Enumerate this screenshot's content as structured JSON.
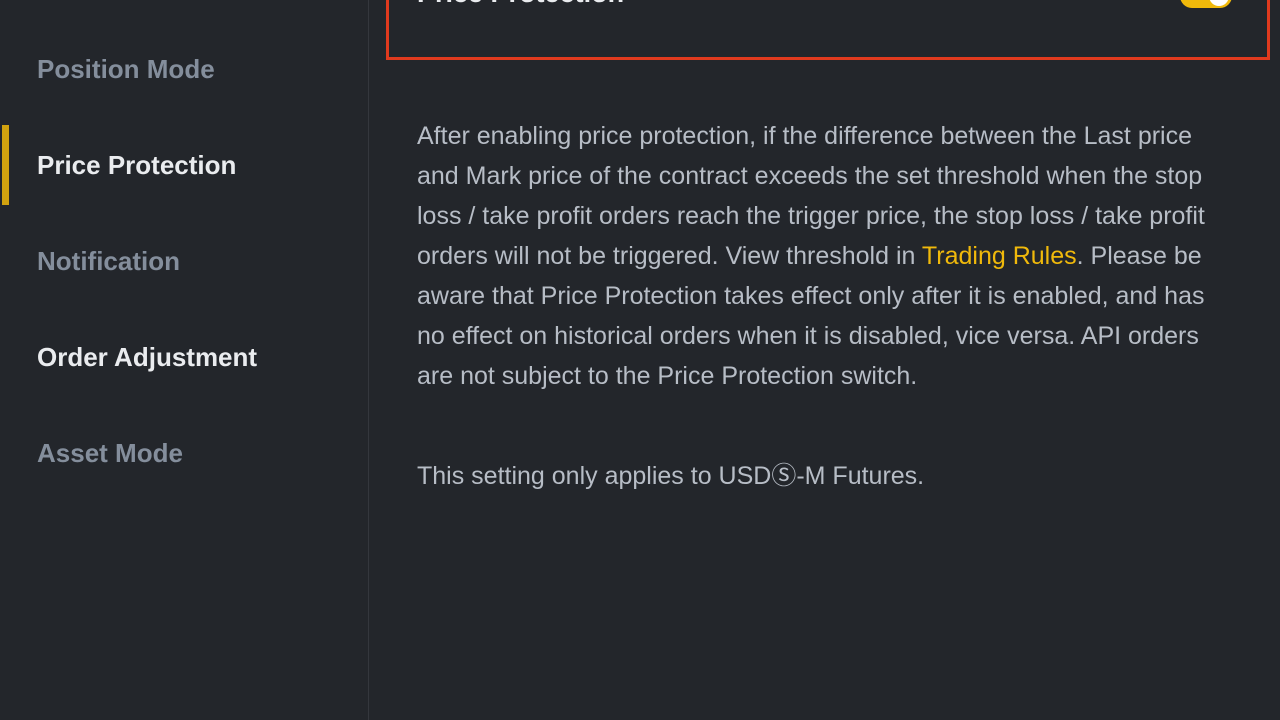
{
  "sidebar": {
    "items": [
      {
        "label": "Position Mode",
        "active": false
      },
      {
        "label": "Price Protection",
        "active": true
      },
      {
        "label": "Notification",
        "active": false
      },
      {
        "label": "Order Adjustment",
        "active": false
      },
      {
        "label": "Asset Mode",
        "active": false
      }
    ]
  },
  "main": {
    "title": "Price Protection",
    "toggle_on": true,
    "description_before_link": "After enabling price protection, if the difference between the Last price and Mark price of the contract exceeds the set threshold when the stop loss / take profit orders reach the trigger price, the stop loss / take profit orders will not be triggered. View threshold in ",
    "link_label": "Trading Rules",
    "description_after_link": ". Please be aware that Price Protection takes effect only after it is enabled, and has no effect on historical orders when it is disabled, vice versa. API orders are not subject to the Price Protection switch.",
    "note": "This setting only applies to USDⓈ-M Futures."
  },
  "colors": {
    "accent": "#f0b90b",
    "highlight": "#e03a1e",
    "background": "#23262b"
  }
}
